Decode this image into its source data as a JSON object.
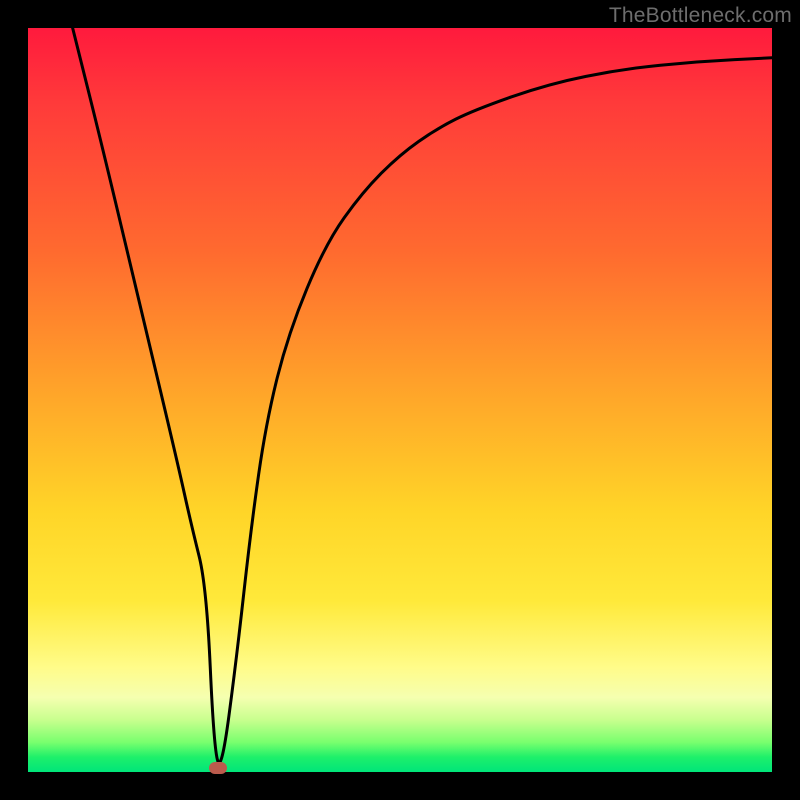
{
  "watermark": "TheBottleneck.com",
  "colors": {
    "frame": "#000000",
    "curve": "#000000",
    "marker": "#bb5b4d",
    "gradient_stops": [
      "#ff1a3d",
      "#ff3a3a",
      "#ff6a2f",
      "#ffa829",
      "#ffd528",
      "#ffe93a",
      "#fffc8a",
      "#f5ffb0",
      "#c8ff8e",
      "#79ff6e",
      "#1ef06a",
      "#00e57a"
    ]
  },
  "chart_data": {
    "type": "line",
    "title": "",
    "xlabel": "",
    "ylabel": "",
    "xlim": [
      0,
      100
    ],
    "ylim": [
      0,
      100
    ],
    "x": [
      6,
      10,
      15,
      20,
      22,
      24,
      25,
      26,
      28,
      30,
      32,
      35,
      40,
      45,
      50,
      55,
      60,
      70,
      80,
      90,
      100
    ],
    "y": [
      100,
      84,
      63,
      42,
      33,
      25,
      3,
      0,
      15,
      33,
      47,
      59,
      71,
      78,
      83,
      86.5,
      89,
      92.5,
      94.5,
      95.5,
      96
    ],
    "marker": {
      "x": 25.5,
      "y": 0.5
    },
    "annotations": []
  }
}
